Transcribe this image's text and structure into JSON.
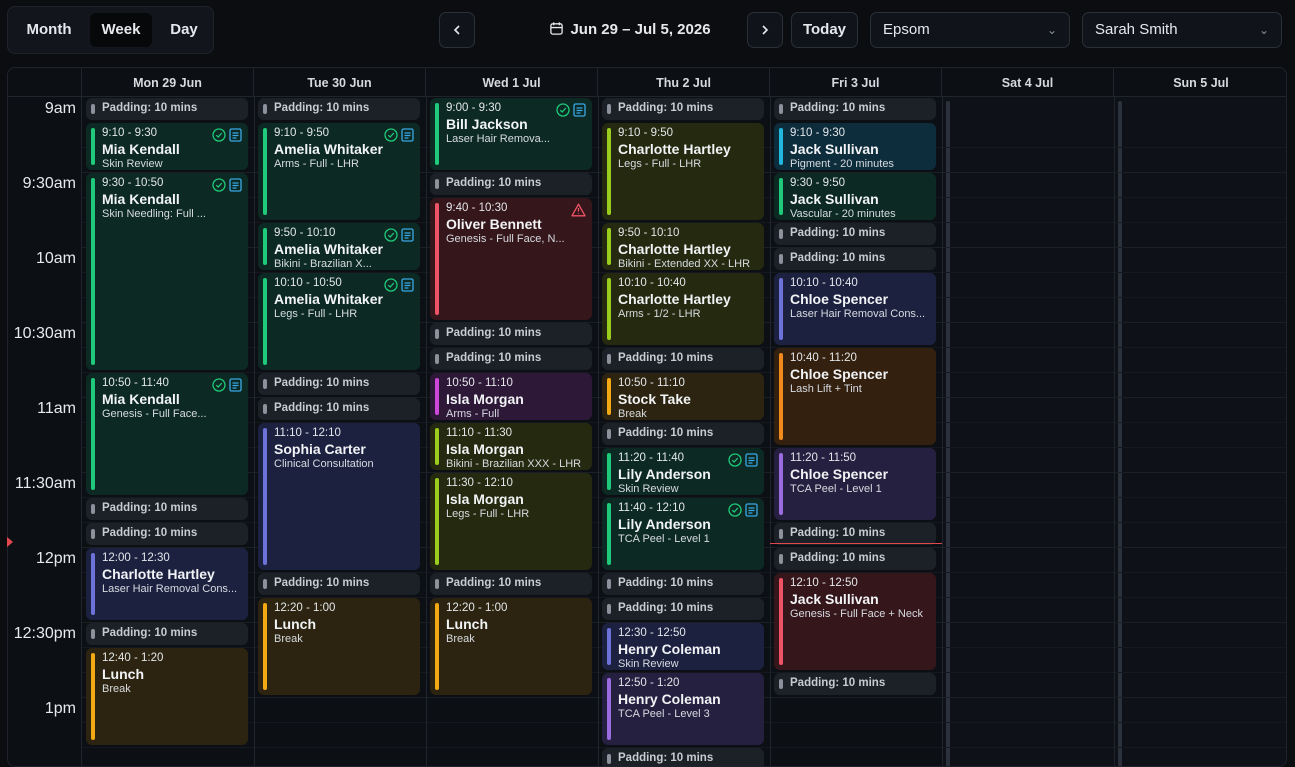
{
  "toolbar": {
    "views": [
      "Month",
      "Week",
      "Day"
    ],
    "active_view": "Week",
    "prev_icon": "chevron-left-icon",
    "next_icon": "chevron-right-icon",
    "date_range": "Jun 29 – Jul 5, 2026",
    "calendar_icon": "calendar-icon",
    "today_label": "Today",
    "location": "Epsom",
    "staff": "Sarah Smith"
  },
  "days": [
    "Mon 29 Jun",
    "Tue 30 Jun",
    "Wed 1 Jul",
    "Thu 2 Jul",
    "Fri 3 Jul",
    "Sat 4 Jul",
    "Sun 5 Jul"
  ],
  "times": [
    "9am",
    "9:30am",
    "10am",
    "10:30am",
    "11am",
    "11:30am",
    "12pm",
    "12:30pm",
    "1pm"
  ],
  "colors": {
    "green": "#1fca7a",
    "olive": "#9acd1e",
    "indigo": "#6d72d9",
    "amber": "#f2a914",
    "red": "#ef5466",
    "purple": "#cd48da",
    "cyan": "#22b7dd",
    "orange": "#f08a1c",
    "violet": "#9b6be0",
    "now_line": "#e0484e"
  },
  "padding_label": "Padding: 10 mins",
  "events": {
    "mon": [
      {
        "time": "9:10 - 9:30",
        "name": "Mia Kendall",
        "service": "Skin Review"
      },
      {
        "time": "9:30 - 10:50",
        "name": "Mia Kendall",
        "service": "Skin Needling: Full ..."
      },
      {
        "time": "10:50 - 11:40",
        "name": "Mia Kendall",
        "service": "Genesis - Full Face..."
      },
      {
        "time": "12:00 - 12:30",
        "name": "Charlotte Hartley",
        "service": "Laser Hair Removal Cons..."
      },
      {
        "time": "12:40 - 1:20",
        "name": "Lunch",
        "service": "Break"
      }
    ],
    "tue": [
      {
        "time": "9:10 - 9:50",
        "name": "Amelia Whitaker",
        "service": "Arms - Full - LHR"
      },
      {
        "time": "9:50 - 10:10",
        "name": "Amelia Whitaker",
        "service": "Bikini - Brazilian X..."
      },
      {
        "time": "10:10 - 10:50",
        "name": "Amelia Whitaker",
        "service": "Legs - Full - LHR"
      },
      {
        "time": "11:10 - 12:10",
        "name": "Sophia Carter",
        "service": "Clinical Consultation"
      },
      {
        "time": "12:20 - 1:00",
        "name": "Lunch",
        "service": "Break"
      }
    ],
    "wed": [
      {
        "time": "9:00 - 9:30",
        "name": "Bill Jackson",
        "service": "Laser Hair Remova..."
      },
      {
        "time": "9:40 - 10:30",
        "name": "Oliver Bennett",
        "service": "Genesis - Full Face, N..."
      },
      {
        "time": "10:50 - 11:10",
        "name": "Isla Morgan",
        "service": "Arms - Full"
      },
      {
        "time": "11:10 - 11:30",
        "name": "Isla Morgan",
        "service": "Bikini - Brazilian XXX - LHR"
      },
      {
        "time": "11:30 - 12:10",
        "name": "Isla Morgan",
        "service": "Legs - Full - LHR"
      },
      {
        "time": "12:20 - 1:00",
        "name": "Lunch",
        "service": "Break"
      }
    ],
    "thu": [
      {
        "time": "9:10 - 9:50",
        "name": "Charlotte Hartley",
        "service": "Legs - Full - LHR"
      },
      {
        "time": "9:50 - 10:10",
        "name": "Charlotte Hartley",
        "service": "Bikini - Extended XX - LHR"
      },
      {
        "time": "10:10 - 10:40",
        "name": "Charlotte Hartley",
        "service": "Arms - 1/2 - LHR"
      },
      {
        "time": "10:50 - 11:10",
        "name": "Stock Take",
        "service": "Break"
      },
      {
        "time": "11:20 - 11:40",
        "name": "Lily Anderson",
        "service": "Skin Review"
      },
      {
        "time": "11:40 - 12:10",
        "name": "Lily Anderson",
        "service": "TCA Peel - Level 1"
      },
      {
        "time": "12:30 - 12:50",
        "name": "Henry Coleman",
        "service": "Skin Review"
      },
      {
        "time": "12:50 - 1:20",
        "name": "Henry Coleman",
        "service": "TCA Peel - Level 3"
      }
    ],
    "fri": [
      {
        "time": "9:10 - 9:30",
        "name": "Jack Sullivan",
        "service": "Pigment - 20 minutes"
      },
      {
        "time": "9:30 - 9:50",
        "name": "Jack Sullivan",
        "service": "Vascular - 20 minutes"
      },
      {
        "time": "10:10 - 10:40",
        "name": "Chloe Spencer",
        "service": "Laser Hair Removal Cons..."
      },
      {
        "time": "10:40 - 11:20",
        "name": "Chloe Spencer",
        "service": "Lash Lift + Tint"
      },
      {
        "time": "11:20 - 11:50",
        "name": "Chloe Spencer",
        "service": "TCA Peel - Level 1"
      },
      {
        "time": "12:10 - 12:50",
        "name": "Jack Sullivan",
        "service": "Genesis - Full Face + Neck"
      }
    ]
  }
}
